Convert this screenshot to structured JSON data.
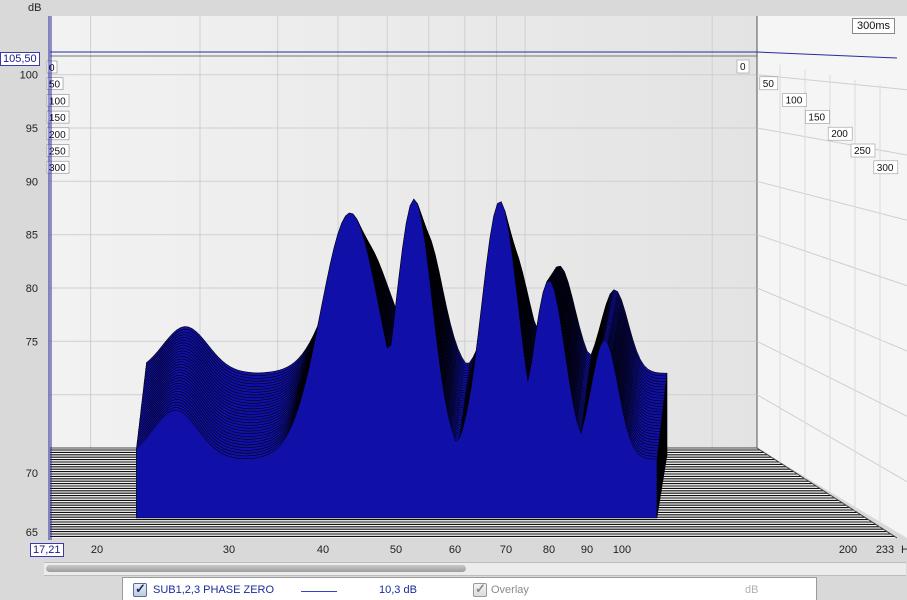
{
  "chart_data": {
    "type": "waterfall-3d",
    "y_unit": "dB",
    "y_ticks": [
      "100",
      "95",
      "90",
      "85",
      "80",
      "75",
      "70",
      "65"
    ],
    "y_cursor": "105,50",
    "x_cursor": "17,21",
    "x_ticks": [
      "20",
      "30",
      "40",
      "50",
      "60",
      "70",
      "80",
      "90",
      "100",
      "200",
      "233"
    ],
    "x_unit_partial": "H",
    "x_range_hz": [
      17.21,
      233
    ],
    "y_range_db": [
      65,
      105.5
    ],
    "time_label": "300ms",
    "time_ticks_left": [
      "0",
      "50",
      "100",
      "150",
      "200",
      "250",
      "300"
    ],
    "time_ticks_right": [
      "0",
      "50",
      "100",
      "150",
      "200",
      "250",
      "300"
    ],
    "peaks_front": [
      {
        "freq": 26,
        "level": 73.8
      },
      {
        "freq": 45,
        "level": 92.3
      },
      {
        "freq": 55,
        "level": 93.6
      },
      {
        "freq": 72,
        "level": 93.4
      },
      {
        "freq": 84,
        "level": 86.0
      },
      {
        "freq": 100,
        "level": 80.4
      }
    ],
    "floor_db": 71.2
  },
  "legend": {
    "series_name": "SUB1,2,3 PHASE ZERO",
    "smoothing_value": "10,3 dB",
    "overlay_label": "Overlay",
    "unit_label": "dB",
    "series_checked": true,
    "overlay_checked": true
  },
  "colors": {
    "surface": "#1010a8",
    "legend_line": "#3344cc"
  }
}
